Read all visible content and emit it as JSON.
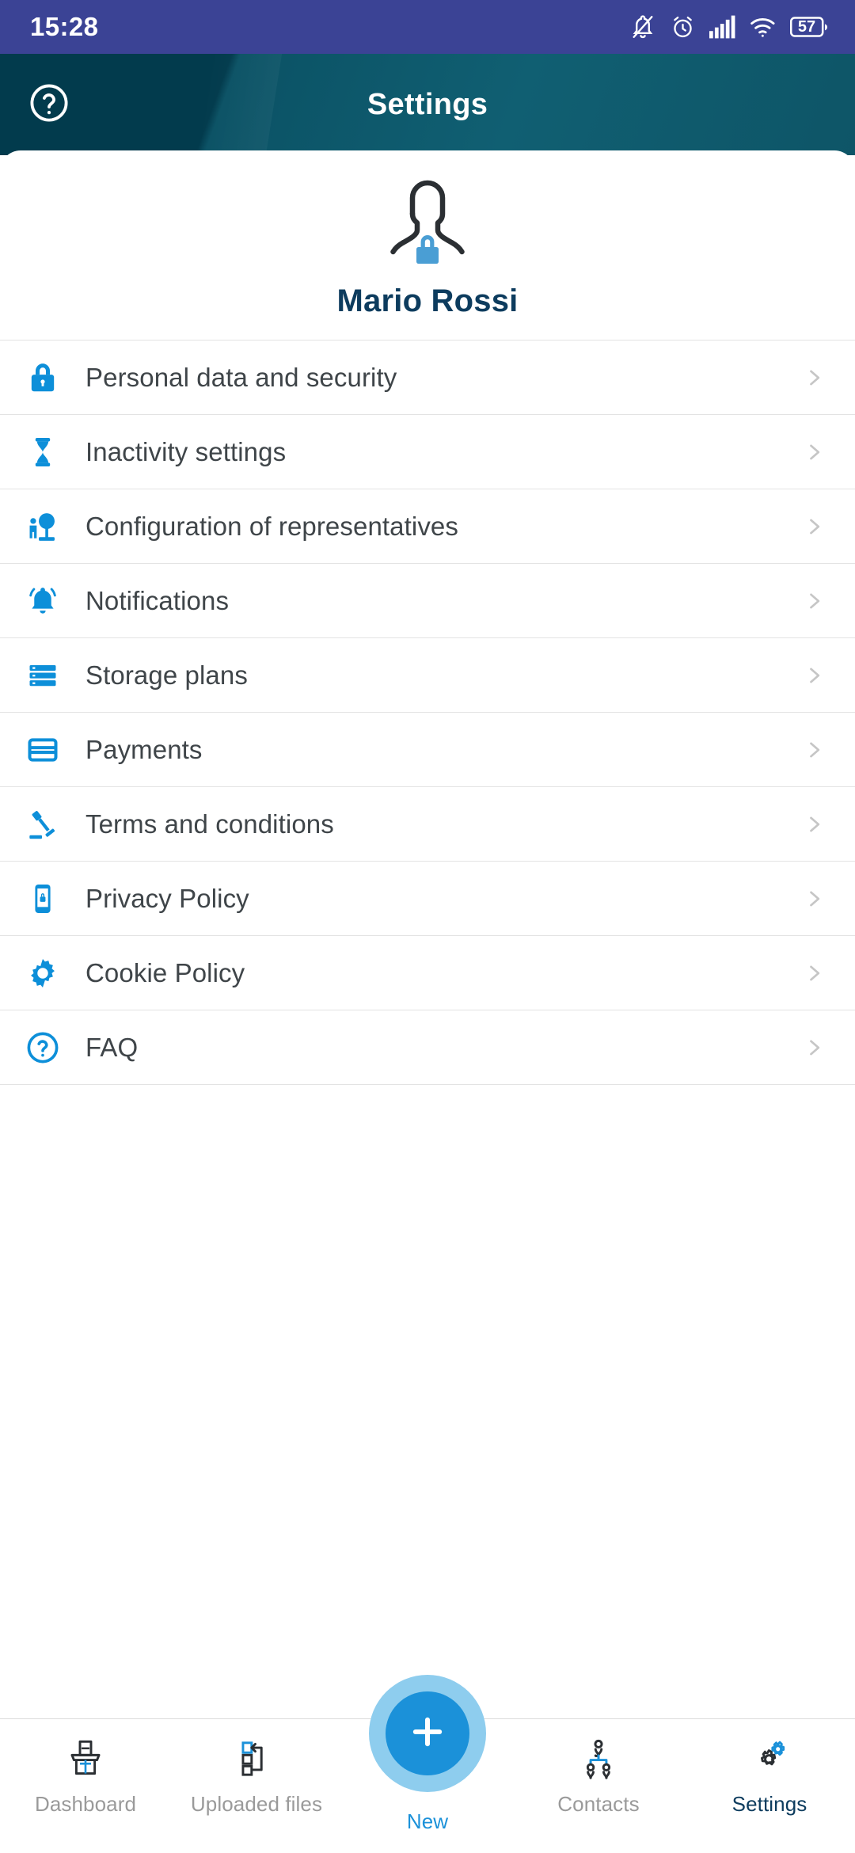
{
  "status_bar": {
    "time": "15:28",
    "battery_percent": "57",
    "icons": [
      "bell-off-icon",
      "alarm-icon",
      "cellular-signal-icon",
      "wifi-icon",
      "battery-icon"
    ],
    "background_color": "#3b4395"
  },
  "header": {
    "title": "Settings",
    "help_icon": "help-circle-icon",
    "background_color": "#0b5265"
  },
  "profile": {
    "name": "Mario Rossi",
    "avatar_icon": "person-outline-icon",
    "badge_icon": "lock-icon",
    "badge_color": "#4a9ed4",
    "name_color": "#0d3c5e"
  },
  "settings_list": {
    "chevron_icon": "chevron-right-icon",
    "accent_color": "#0d8fd9",
    "items": [
      {
        "label": "Personal data and security",
        "icon": "lock-icon"
      },
      {
        "label": "Inactivity settings",
        "icon": "hourglass-icon"
      },
      {
        "label": "Configuration of representatives",
        "icon": "podium-speaker-icon"
      },
      {
        "label": "Notifications",
        "icon": "bell-icon"
      },
      {
        "label": "Storage plans",
        "icon": "storage-server-icon"
      },
      {
        "label": "Payments",
        "icon": "credit-card-icon"
      },
      {
        "label": "Terms and conditions",
        "icon": "gavel-icon"
      },
      {
        "label": "Privacy Policy",
        "icon": "phone-lock-icon"
      },
      {
        "label": "Cookie Policy",
        "icon": "gear-icon"
      },
      {
        "label": "FAQ",
        "icon": "help-circle-icon"
      }
    ]
  },
  "bottom_nav": {
    "items": [
      {
        "label": "Dashboard",
        "icon": "lectern-podium-icon",
        "state": "inactive"
      },
      {
        "label": "Uploaded files",
        "icon": "flowchart-upload-icon",
        "state": "inactive"
      },
      {
        "label": "New",
        "icon": "plus-icon",
        "state": "fab"
      },
      {
        "label": "Contacts",
        "icon": "org-chart-people-icon",
        "state": "inactive"
      },
      {
        "label": "Settings",
        "icon": "gears-icon",
        "state": "active"
      }
    ],
    "fab_color": "#1b91d9",
    "fab_halo_color": "#8ecdee"
  }
}
